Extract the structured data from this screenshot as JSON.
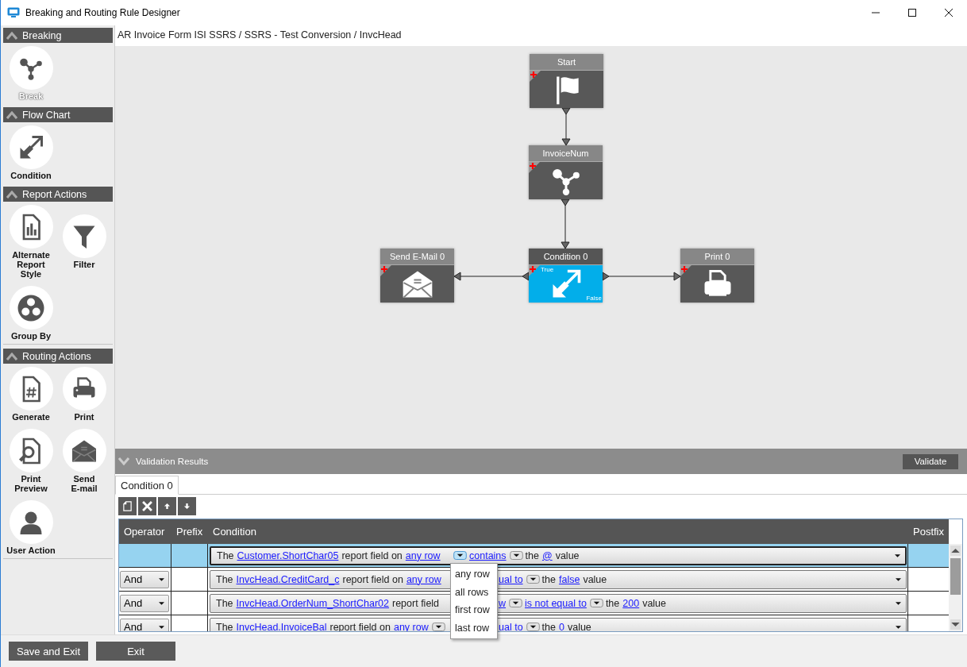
{
  "window": {
    "title": "Breaking and Routing Rule Designer"
  },
  "sidebar": {
    "sections": [
      {
        "title": "Breaking",
        "expanded": true,
        "items": [
          {
            "label": "Break",
            "kind": "break",
            "disabled": true
          }
        ]
      },
      {
        "title": "Flow Chart",
        "expanded": true,
        "items": [
          {
            "label": "Condition",
            "kind": "condition",
            "disabled": false
          }
        ]
      },
      {
        "title": "Report Actions",
        "expanded": true,
        "items": [
          {
            "label": "Alternate\nReport\nStyle",
            "kind": "report",
            "disabled": false
          },
          {
            "label": "Filter",
            "kind": "filter",
            "disabled": false
          },
          {
            "label": "Group By",
            "kind": "group",
            "disabled": false
          }
        ]
      },
      {
        "title": "Routing Actions",
        "expanded": true,
        "items": [
          {
            "label": "Generate",
            "kind": "generate",
            "disabled": false
          },
          {
            "label": "Print",
            "kind": "print",
            "disabled": false
          },
          {
            "label": "Print\nPreview",
            "kind": "preview",
            "disabled": false
          },
          {
            "label": "Send\nE-mail",
            "kind": "email",
            "disabled": false
          },
          {
            "label": "User Action",
            "kind": "user",
            "disabled": false
          }
        ]
      }
    ]
  },
  "breadcrumb": "AR Invoice Form ISI SSRS / SSRS - Test Conversion / InvcHead",
  "diagram": {
    "nodes": [
      {
        "title": "Start",
        "kind": "flag",
        "selected": false
      },
      {
        "title": "InvoiceNum",
        "kind": "break",
        "selected": false
      },
      {
        "title": "Send E-Mail 0",
        "kind": "email",
        "selected": false
      },
      {
        "title": "Condition 0",
        "kind": "condition",
        "selected": true,
        "true_label": "True",
        "false_label": "False"
      },
      {
        "title": "Print 0",
        "kind": "print",
        "selected": false
      }
    ]
  },
  "validation": {
    "title": "Validation Results",
    "expanded": false,
    "button": "Validate"
  },
  "tabs": [
    {
      "label": "Condition 0",
      "selected": true
    }
  ],
  "table": {
    "columns": [
      "Operator",
      "Prefix",
      "Condition",
      "Postfix"
    ],
    "rows": [
      {
        "selected": true,
        "covered": false,
        "before": [
          {
            "kind": "text",
            "text": "The"
          },
          {
            "kind": "link",
            "text": "Customer.ShortChar05"
          },
          {
            "kind": "text",
            "text": "report field on"
          },
          {
            "kind": "link",
            "text": "any row"
          }
        ],
        "after": [
          {
            "kind": "dropdown",
            "open": true
          },
          {
            "kind": "link",
            "text": "contains"
          },
          {
            "kind": "dropdown",
            "open": false
          },
          {
            "kind": "text",
            "text": "the"
          },
          {
            "kind": "link",
            "text": "@"
          },
          {
            "kind": "text",
            "text": "value"
          }
        ]
      },
      {
        "selected": false,
        "operator": "And",
        "covered": true,
        "before": [
          {
            "kind": "text",
            "text": "The"
          },
          {
            "kind": "link",
            "text": "InvcHead.CreditCard_c"
          },
          {
            "kind": "text",
            "text": "report field on"
          },
          {
            "kind": "link",
            "text": "any row"
          }
        ],
        "after": [
          {
            "kind": "link",
            "text": "ual to"
          },
          {
            "kind": "dropdown",
            "open": false
          },
          {
            "kind": "text",
            "text": "the"
          },
          {
            "kind": "link",
            "text": "false"
          },
          {
            "kind": "text",
            "text": "value"
          }
        ]
      },
      {
        "selected": false,
        "operator": "And",
        "covered": true,
        "before": [
          {
            "kind": "text",
            "text": "The"
          },
          {
            "kind": "link",
            "text": "InvcHead.OrderNum_ShortChar02"
          },
          {
            "kind": "text",
            "text": "report field"
          }
        ],
        "after": [
          {
            "kind": "link",
            "text": "w"
          },
          {
            "kind": "dropdown",
            "open": false
          },
          {
            "kind": "link",
            "text": "is not equal to"
          },
          {
            "kind": "dropdown",
            "open": false
          },
          {
            "kind": "text",
            "text": "the"
          },
          {
            "kind": "link",
            "text": "200"
          },
          {
            "kind": "text",
            "text": "value"
          }
        ]
      },
      {
        "selected": false,
        "operator": "And",
        "covered": true,
        "before": [
          {
            "kind": "text",
            "text": "The"
          },
          {
            "kind": "link",
            "text": "InvcHead.InvoiceBal"
          },
          {
            "kind": "text",
            "text": "report field on"
          },
          {
            "kind": "link",
            "text": "any row"
          },
          {
            "kind": "dropdown",
            "open": false
          }
        ],
        "after": [
          {
            "kind": "link",
            "text": "ual to"
          },
          {
            "kind": "dropdown",
            "open": false
          },
          {
            "kind": "text",
            "text": "the"
          },
          {
            "kind": "link",
            "text": "0"
          },
          {
            "kind": "text",
            "text": "value"
          }
        ]
      }
    ]
  },
  "dropdown_menu": [
    "any row",
    "all rows",
    "first row",
    "last row"
  ],
  "buttons": [
    "Save and Exit",
    "Exit"
  ]
}
